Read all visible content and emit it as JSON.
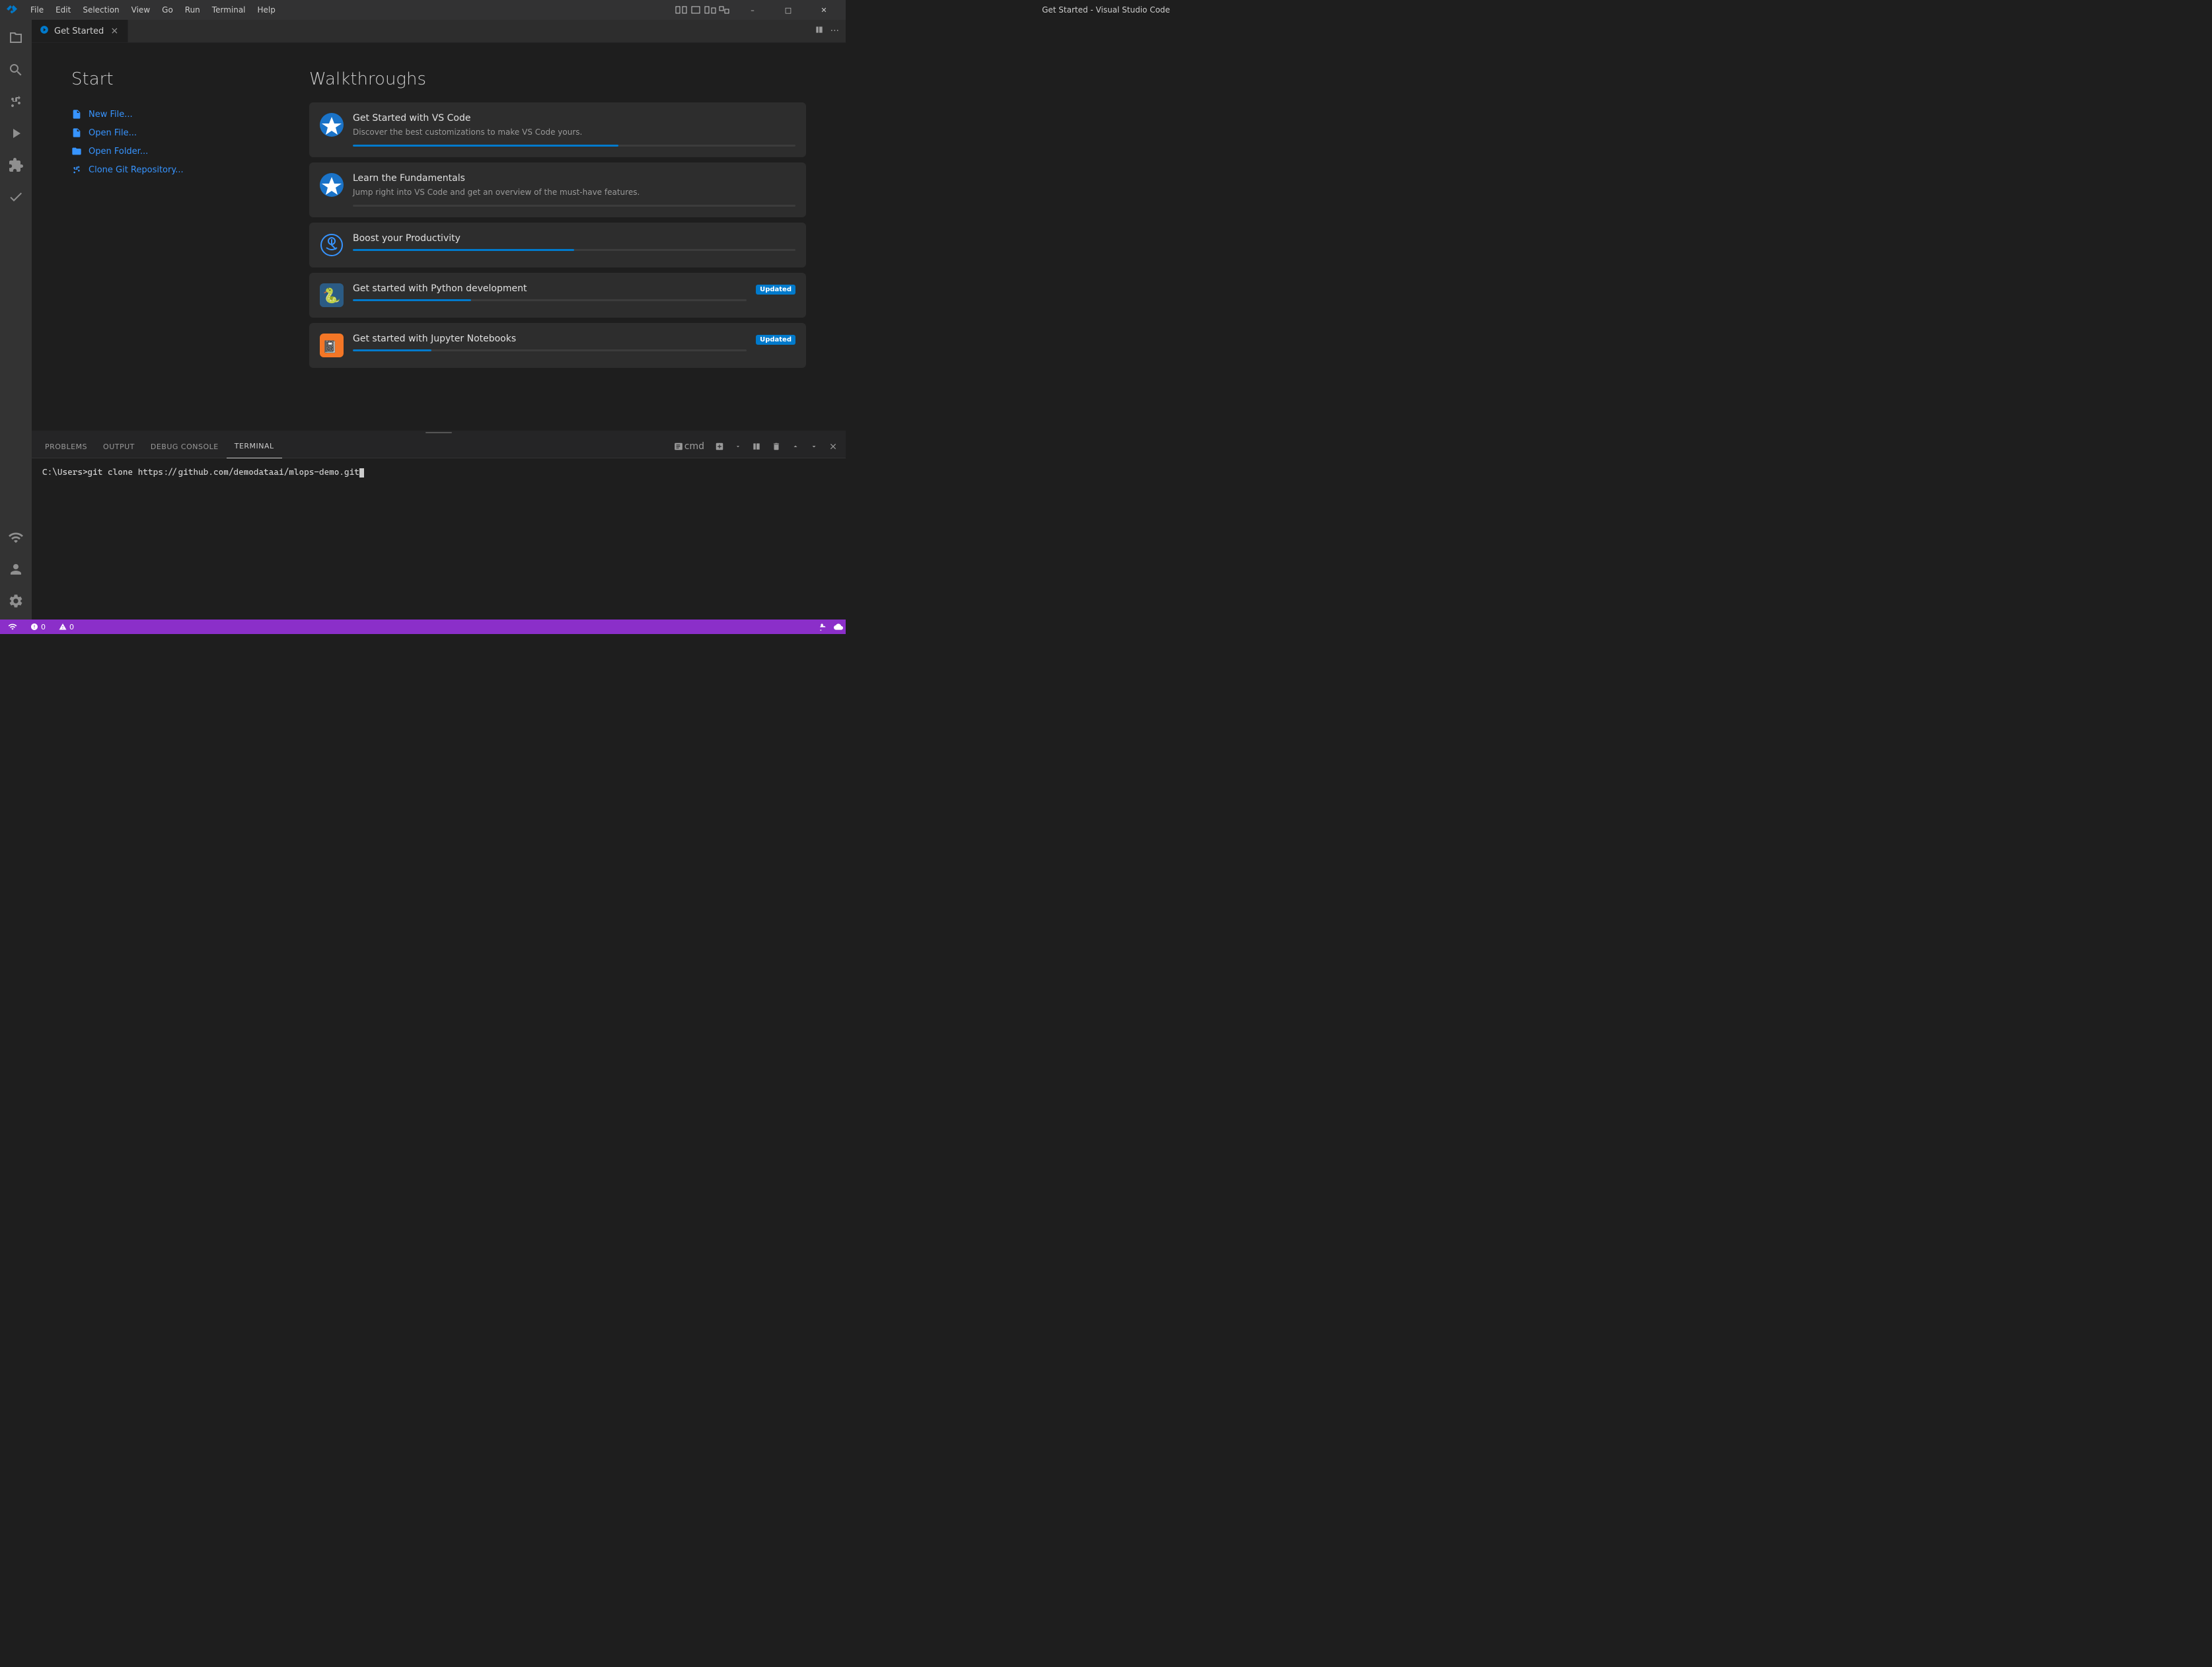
{
  "titlebar": {
    "logo": "✦",
    "menu_items": [
      "File",
      "Edit",
      "Selection",
      "View",
      "Go",
      "Run",
      "Terminal",
      "Help"
    ],
    "title": "Get Started - Visual Studio Code",
    "window_controls": {
      "minimize": "–",
      "maximize": "□",
      "close": "✕"
    }
  },
  "activity_bar": {
    "items": [
      {
        "name": "explorer",
        "icon": "files",
        "label": "Explorer",
        "active": true
      },
      {
        "name": "search",
        "icon": "search",
        "label": "Search"
      },
      {
        "name": "source-control",
        "icon": "git",
        "label": "Source Control"
      },
      {
        "name": "run-debug",
        "icon": "debug",
        "label": "Run and Debug"
      },
      {
        "name": "extensions",
        "icon": "extensions",
        "label": "Extensions"
      },
      {
        "name": "testing",
        "icon": "testing",
        "label": "Testing"
      },
      {
        "name": "remote-explorer",
        "icon": "remote",
        "label": "Remote Explorer"
      }
    ],
    "bottom": [
      {
        "name": "account",
        "label": "Account"
      },
      {
        "name": "settings",
        "label": "Settings"
      }
    ]
  },
  "tab": {
    "title": "Get Started",
    "icon": "⚡",
    "close_label": "×"
  },
  "tab_actions": {
    "split_editor": "⊟",
    "more": "···"
  },
  "get_started": {
    "start_section": {
      "title": "Start",
      "items": [
        {
          "icon": "📄",
          "label": "New File..."
        },
        {
          "icon": "📂",
          "label": "Open File..."
        },
        {
          "icon": "📁",
          "label": "Open Folder..."
        },
        {
          "icon": "🔀",
          "label": "Clone Git Repository..."
        }
      ]
    },
    "walkthroughs_section": {
      "title": "Walkthroughs",
      "cards": [
        {
          "id": "get-started-vs-code",
          "icon_type": "star",
          "title": "Get Started with VS Code",
          "description": "Discover the best customizations to make VS Code yours.",
          "progress": 60,
          "badge": null
        },
        {
          "id": "learn-fundamentals",
          "icon_type": "star",
          "title": "Learn the Fundamentals",
          "description": "Jump right into VS Code and get an overview of the must-have features.",
          "progress": 0,
          "badge": null
        },
        {
          "id": "boost-productivity",
          "icon_type": "graduate",
          "title": "Boost your Productivity",
          "description": null,
          "progress": 50,
          "badge": null
        },
        {
          "id": "get-started-python",
          "icon_type": "python",
          "title": "Get started with Python development",
          "description": null,
          "progress": 30,
          "badge": "Updated"
        },
        {
          "id": "get-started-jupyter",
          "icon_type": "jupyter",
          "title": "Get started with Jupyter Notebooks",
          "description": null,
          "progress": 20,
          "badge": "Updated"
        }
      ]
    }
  },
  "panel": {
    "tabs": [
      "PROBLEMS",
      "OUTPUT",
      "DEBUG CONSOLE",
      "TERMINAL"
    ],
    "active_tab": "TERMINAL",
    "terminal_label": "cmd",
    "terminal_content": "C:\\Users>git clone https://github.com/demodataai/mlops-demo.git",
    "actions": {
      "new_terminal": "+",
      "split": "⊟",
      "kill": "🗑",
      "scroll_up": "⌃",
      "scroll_down": "⌄",
      "close": "✕"
    }
  },
  "status_bar": {
    "left_items": [
      {
        "icon": "⚙",
        "label": "0"
      },
      {
        "icon": "⚠",
        "label": "0"
      }
    ],
    "right_items": [
      {
        "label": "🔔"
      },
      {
        "label": "☁"
      }
    ]
  }
}
